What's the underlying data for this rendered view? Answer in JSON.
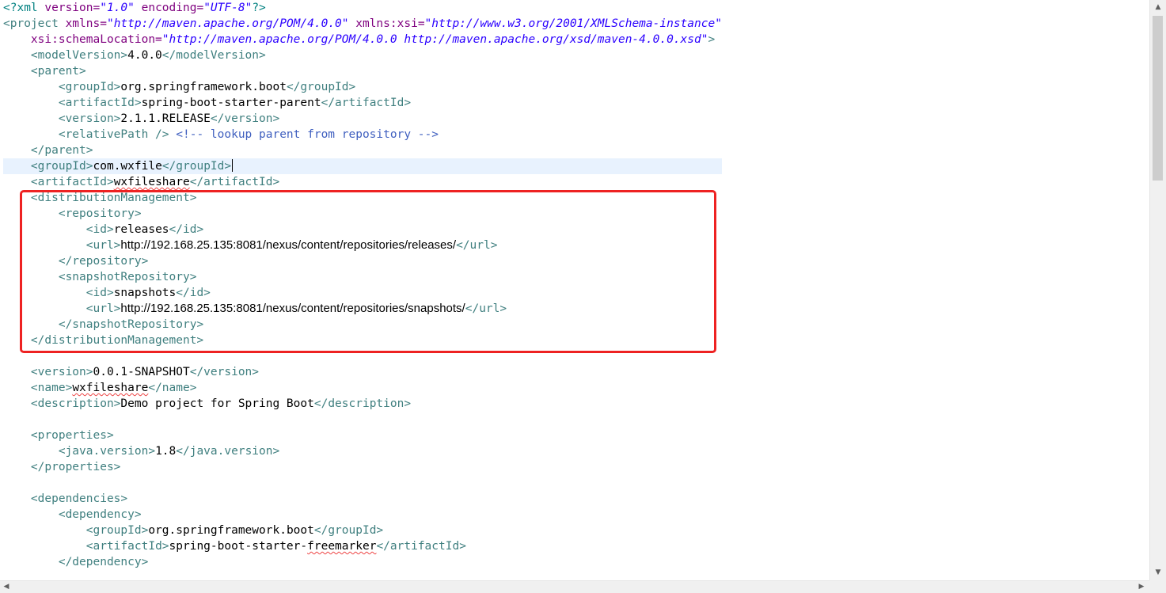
{
  "editor": {
    "lines": [
      [
        [
          "pi",
          "<?xml "
        ],
        [
          "at",
          "version="
        ],
        [
          "av",
          "\"1.0\""
        ],
        [
          "at",
          " encoding="
        ],
        [
          "av",
          "\"UTF-8\""
        ],
        [
          "pi",
          "?>"
        ]
      ],
      [
        [
          "t",
          "<project "
        ],
        [
          "at",
          "xmlns="
        ],
        [
          "av",
          "\"http://maven.apache.org/POM/4.0.0\""
        ],
        [
          "at",
          " xmlns:xsi="
        ],
        [
          "av",
          "\"http://www.w3.org/2001/XMLSchema-instance\""
        ]
      ],
      [
        [
          "tx",
          "    "
        ],
        [
          "at",
          "xsi:schemaLocation="
        ],
        [
          "av",
          "\"http://maven.apache.org/POM/4.0.0 http://maven.apache.org/xsd/maven-4.0.0.xsd\""
        ],
        [
          "t",
          ">"
        ]
      ],
      [
        [
          "tx",
          "    "
        ],
        [
          "t",
          "<modelVersion>"
        ],
        [
          "tx",
          "4.0.0"
        ],
        [
          "t",
          "</modelVersion>"
        ]
      ],
      [
        [
          "tx",
          "    "
        ],
        [
          "t",
          "<parent>"
        ]
      ],
      [
        [
          "tx",
          "        "
        ],
        [
          "t",
          "<groupId>"
        ],
        [
          "tx",
          "org.springframework.boot"
        ],
        [
          "t",
          "</groupId>"
        ]
      ],
      [
        [
          "tx",
          "        "
        ],
        [
          "t",
          "<artifactId>"
        ],
        [
          "tx",
          "spring-boot-starter-parent"
        ],
        [
          "t",
          "</artifactId>"
        ]
      ],
      [
        [
          "tx",
          "        "
        ],
        [
          "t",
          "<version>"
        ],
        [
          "tx",
          "2.1.1.RELEASE"
        ],
        [
          "t",
          "</version>"
        ]
      ],
      [
        [
          "tx",
          "        "
        ],
        [
          "t",
          "<relativePath /> "
        ],
        [
          "cm",
          "<!-- lookup parent from repository -->"
        ]
      ],
      [
        [
          "tx",
          "    "
        ],
        [
          "t",
          "</parent>"
        ]
      ],
      [
        [
          "tx",
          "    "
        ],
        [
          "t",
          "<groupId>"
        ],
        [
          "tx",
          "com.wxfile"
        ],
        [
          "t",
          "</groupId>"
        ],
        [
          "caret",
          ""
        ]
      ],
      [
        [
          "tx",
          "    "
        ],
        [
          "t",
          "<artifactId>"
        ],
        [
          "sq",
          "wxfileshare"
        ],
        [
          "t",
          "</artifactId>"
        ]
      ],
      [
        [
          "tx",
          "    "
        ],
        [
          "t",
          "<distributionManagement>"
        ]
      ],
      [
        [
          "tx",
          "        "
        ],
        [
          "t",
          "<repository>"
        ]
      ],
      [
        [
          "tx",
          "            "
        ],
        [
          "t",
          "<id>"
        ],
        [
          "tx",
          "releases"
        ],
        [
          "t",
          "</id>"
        ]
      ],
      [
        [
          "tx",
          "            "
        ],
        [
          "t",
          "<url>"
        ],
        [
          "sans",
          "http://192.168.25.135:8081/nexus/content/repositories/releases/"
        ],
        [
          "t",
          "</url>"
        ]
      ],
      [
        [
          "tx",
          "        "
        ],
        [
          "t",
          "</repository>"
        ]
      ],
      [
        [
          "tx",
          "        "
        ],
        [
          "t",
          "<snapshotRepository>"
        ]
      ],
      [
        [
          "tx",
          "            "
        ],
        [
          "t",
          "<id>"
        ],
        [
          "tx",
          "snapshots"
        ],
        [
          "t",
          "</id>"
        ]
      ],
      [
        [
          "tx",
          "            "
        ],
        [
          "t",
          "<url>"
        ],
        [
          "sans",
          "http://192.168.25.135:8081/nexus/content/repositories/snapshots/"
        ],
        [
          "t",
          "</url>"
        ]
      ],
      [
        [
          "tx",
          "        "
        ],
        [
          "t",
          "</snapshotRepository>"
        ]
      ],
      [
        [
          "tx",
          "    "
        ],
        [
          "t",
          "</distributionManagement>"
        ]
      ],
      [],
      [
        [
          "tx",
          "    "
        ],
        [
          "t",
          "<version>"
        ],
        [
          "tx",
          "0.0.1-SNAPSHOT"
        ],
        [
          "t",
          "</version>"
        ]
      ],
      [
        [
          "tx",
          "    "
        ],
        [
          "t",
          "<name>"
        ],
        [
          "sq",
          "wxfileshare"
        ],
        [
          "t",
          "</name>"
        ]
      ],
      [
        [
          "tx",
          "    "
        ],
        [
          "t",
          "<description>"
        ],
        [
          "tx",
          "Demo project for Spring Boot"
        ],
        [
          "t",
          "</description>"
        ]
      ],
      [],
      [
        [
          "tx",
          "    "
        ],
        [
          "t",
          "<properties>"
        ]
      ],
      [
        [
          "tx",
          "        "
        ],
        [
          "t",
          "<java.version>"
        ],
        [
          "tx",
          "1.8"
        ],
        [
          "t",
          "</java.version>"
        ]
      ],
      [
        [
          "tx",
          "    "
        ],
        [
          "t",
          "</properties>"
        ]
      ],
      [],
      [
        [
          "tx",
          "    "
        ],
        [
          "t",
          "<dependencies>"
        ]
      ],
      [
        [
          "tx",
          "        "
        ],
        [
          "t",
          "<dependency>"
        ]
      ],
      [
        [
          "tx",
          "            "
        ],
        [
          "t",
          "<groupId>"
        ],
        [
          "tx",
          "org.springframework.boot"
        ],
        [
          "t",
          "</groupId>"
        ]
      ],
      [
        [
          "tx",
          "            "
        ],
        [
          "t",
          "<artifactId>"
        ],
        [
          "tx",
          "spring-boot-starter-"
        ],
        [
          "sq",
          "freemarker"
        ],
        [
          "t",
          "</artifactId>"
        ]
      ],
      [
        [
          "tx",
          "        "
        ],
        [
          "t",
          "</dependency>"
        ]
      ]
    ],
    "current_line_index": 10,
    "colors": {
      "tag": "#3f7f7f",
      "attribute": "#7f007f",
      "attribute_value": "#2a00ff",
      "comment": "#3f5fbf",
      "processing_instruction": "#008080",
      "current_line_background": "#e8f2fe",
      "highlight_box": "#ee2222"
    }
  },
  "scrollbars": {
    "up_icon": "▲",
    "down_icon": "▼",
    "left_icon": "◀",
    "right_icon": "▶"
  }
}
